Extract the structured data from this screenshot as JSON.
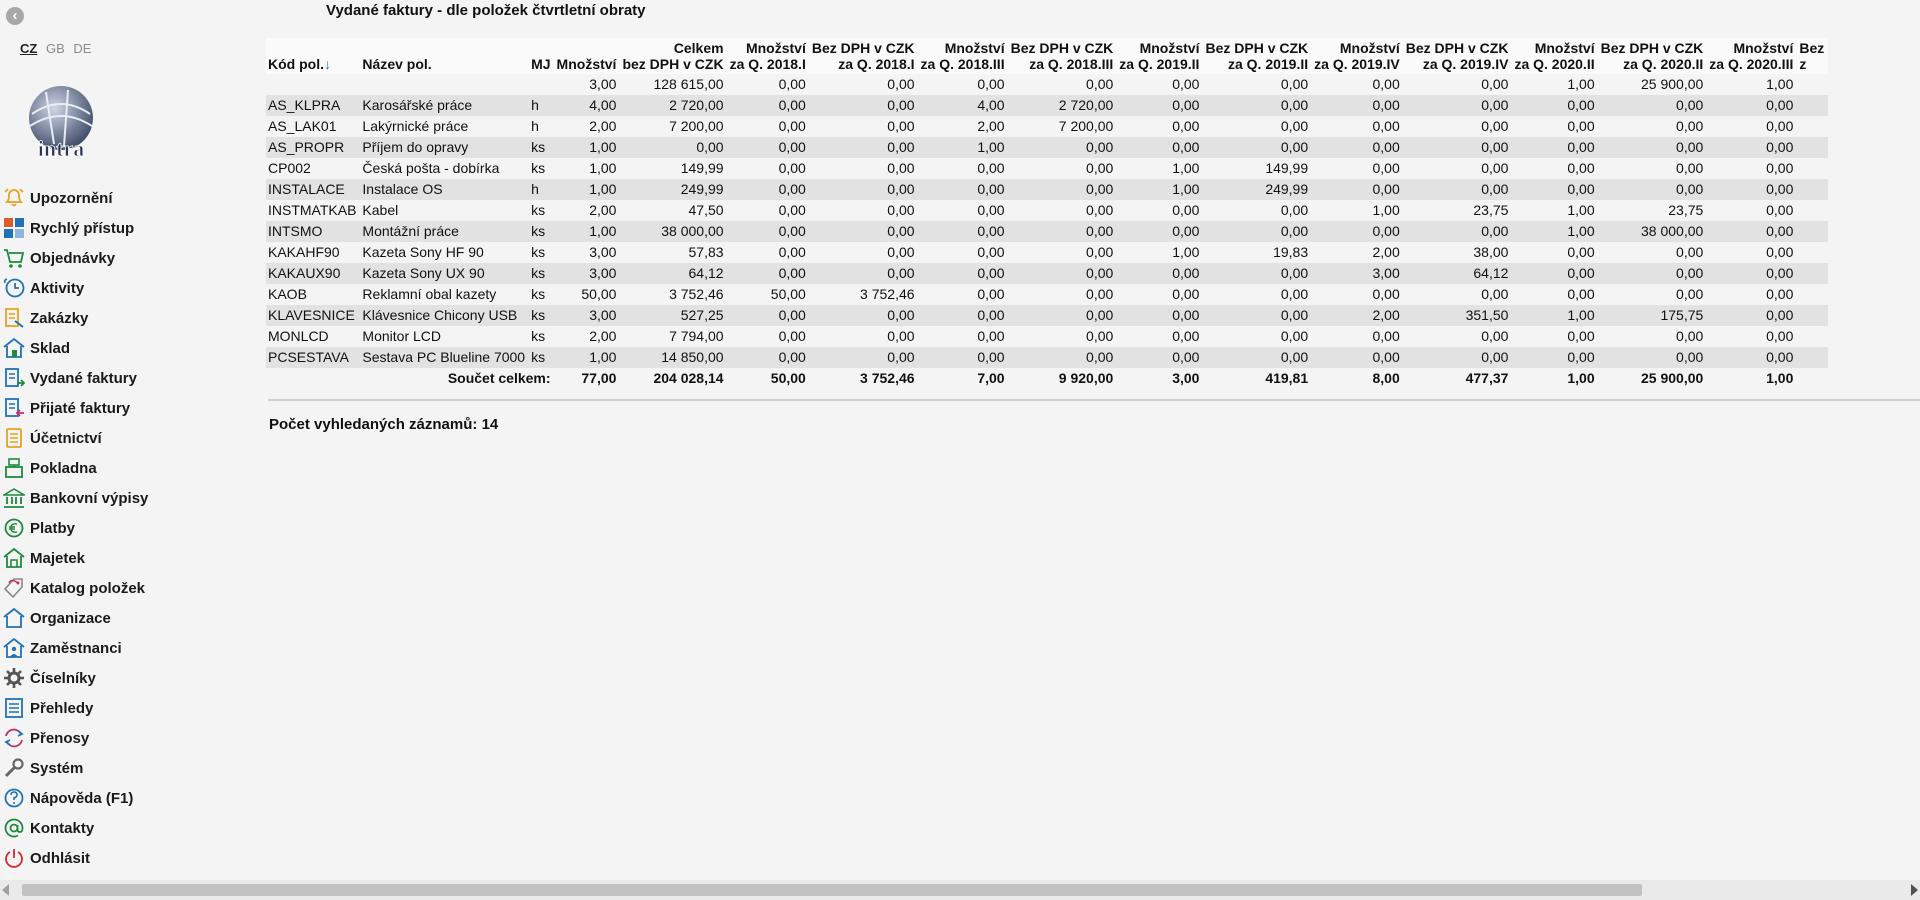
{
  "page_title": "Vydané faktury - dle položek čtvrtletní obraty",
  "languages": [
    "CZ",
    "GB",
    "DE"
  ],
  "logo_text": "intra",
  "nav": [
    {
      "label": "Upozornění",
      "icon": "bell-icon",
      "color": "#e8a21b"
    },
    {
      "label": "Rychlý přístup",
      "icon": "quick-access-icon",
      "color": "#e05a2a"
    },
    {
      "label": "Objednávky",
      "icon": "cart-icon",
      "color": "#1e8a3c"
    },
    {
      "label": "Aktivity",
      "icon": "clock-icon",
      "color": "#1f72b8"
    },
    {
      "label": "Zakázky",
      "icon": "contracts-icon",
      "color": "#e8a21b"
    },
    {
      "label": "Sklad",
      "icon": "warehouse-icon",
      "color": "#1f72b8"
    },
    {
      "label": "Vydané faktury",
      "icon": "issued-invoice-icon",
      "color": "#1f72b8"
    },
    {
      "label": "Přijaté faktury",
      "icon": "received-invoice-icon",
      "color": "#1f72b8"
    },
    {
      "label": "Účetnictví",
      "icon": "accounting-icon",
      "color": "#e8a21b"
    },
    {
      "label": "Pokladna",
      "icon": "cash-register-icon",
      "color": "#1e8a3c"
    },
    {
      "label": "Bankovní výpisy",
      "icon": "bank-icon",
      "color": "#1e8a3c"
    },
    {
      "label": "Platby",
      "icon": "payments-icon",
      "color": "#1e8a3c"
    },
    {
      "label": "Majetek",
      "icon": "property-icon",
      "color": "#1e8a3c"
    },
    {
      "label": "Katalog položek",
      "icon": "tag-icon",
      "color": "#c0306a"
    },
    {
      "label": "Organizace",
      "icon": "organization-icon",
      "color": "#1f72b8"
    },
    {
      "label": "Zaměstnanci",
      "icon": "employees-icon",
      "color": "#1f72b8"
    },
    {
      "label": "Číselníky",
      "icon": "gear-icon",
      "color": "#555555"
    },
    {
      "label": "Přehledy",
      "icon": "list-icon",
      "color": "#1f72b8"
    },
    {
      "label": "Přenosy",
      "icon": "sync-icon",
      "color": "#c0306a"
    },
    {
      "label": "Systém",
      "icon": "wrench-icon",
      "color": "#666666"
    },
    {
      "label": "Nápověda (F1)",
      "icon": "help-icon",
      "color": "#1f72b8"
    },
    {
      "label": "Kontakty",
      "icon": "at-icon",
      "color": "#1e8a3c"
    },
    {
      "label": "Odhlásit",
      "icon": "power-icon",
      "color": "#d62828"
    }
  ],
  "table": {
    "headers": [
      {
        "l1": "",
        "l2": "Kód pol.",
        "sort": "↓",
        "align": "l"
      },
      {
        "l1": "",
        "l2": "Název pol.",
        "align": "l"
      },
      {
        "l1": "",
        "l2": "MJ",
        "align": "l"
      },
      {
        "l1": "",
        "l2": "Množství",
        "align": "r"
      },
      {
        "l1": "Celkem",
        "l2": "bez DPH v CZK",
        "align": "r"
      },
      {
        "l1": "Množství",
        "l2": "za Q. 2018.I",
        "align": "r"
      },
      {
        "l1": "Bez DPH v CZK",
        "l2": "za Q. 2018.I",
        "align": "r"
      },
      {
        "l1": "Množství",
        "l2": "za Q. 2018.III",
        "align": "r"
      },
      {
        "l1": "Bez DPH v CZK",
        "l2": "za Q. 2018.III",
        "align": "r"
      },
      {
        "l1": "Množství",
        "l2": "za Q. 2019.II",
        "align": "r"
      },
      {
        "l1": "Bez DPH v CZK",
        "l2": "za Q. 2019.II",
        "align": "r"
      },
      {
        "l1": "Množství",
        "l2": "za Q. 2019.IV",
        "align": "r"
      },
      {
        "l1": "Bez DPH v CZK",
        "l2": "za Q. 2019.IV",
        "align": "r"
      },
      {
        "l1": "Množství",
        "l2": "za Q. 2020.II",
        "align": "r"
      },
      {
        "l1": "Bez DPH v CZK",
        "l2": "za Q. 2020.II",
        "align": "r"
      },
      {
        "l1": "Množství",
        "l2": "za Q. 2020.III",
        "align": "r"
      },
      {
        "l1": "Bez",
        "l2": "z",
        "align": "l"
      }
    ],
    "rows": [
      [
        "",
        "",
        "",
        "3,00",
        "128 615,00",
        "0,00",
        "0,00",
        "0,00",
        "0,00",
        "0,00",
        "0,00",
        "0,00",
        "0,00",
        "1,00",
        "25 900,00",
        "1,00",
        ""
      ],
      [
        "AS_KLPRA",
        "Karosářské práce",
        "h",
        "4,00",
        "2 720,00",
        "0,00",
        "0,00",
        "4,00",
        "2 720,00",
        "0,00",
        "0,00",
        "0,00",
        "0,00",
        "0,00",
        "0,00",
        "0,00",
        ""
      ],
      [
        "AS_LAK01",
        "Lakýrnické práce",
        "h",
        "2,00",
        "7 200,00",
        "0,00",
        "0,00",
        "2,00",
        "7 200,00",
        "0,00",
        "0,00",
        "0,00",
        "0,00",
        "0,00",
        "0,00",
        "0,00",
        ""
      ],
      [
        "AS_PROPR",
        "Příjem do opravy",
        "ks",
        "1,00",
        "0,00",
        "0,00",
        "0,00",
        "1,00",
        "0,00",
        "0,00",
        "0,00",
        "0,00",
        "0,00",
        "0,00",
        "0,00",
        "0,00",
        ""
      ],
      [
        "CP002",
        "Česká pošta - dobírka",
        "ks",
        "1,00",
        "149,99",
        "0,00",
        "0,00",
        "0,00",
        "0,00",
        "1,00",
        "149,99",
        "0,00",
        "0,00",
        "0,00",
        "0,00",
        "0,00",
        ""
      ],
      [
        "INSTALACE",
        "Instalace OS",
        "h",
        "1,00",
        "249,99",
        "0,00",
        "0,00",
        "0,00",
        "0,00",
        "1,00",
        "249,99",
        "0,00",
        "0,00",
        "0,00",
        "0,00",
        "0,00",
        ""
      ],
      [
        "INSTMATKAB",
        "Kabel",
        "ks",
        "2,00",
        "47,50",
        "0,00",
        "0,00",
        "0,00",
        "0,00",
        "0,00",
        "0,00",
        "1,00",
        "23,75",
        "1,00",
        "23,75",
        "0,00",
        ""
      ],
      [
        "INTSMO",
        "Montážní práce",
        "ks",
        "1,00",
        "38 000,00",
        "0,00",
        "0,00",
        "0,00",
        "0,00",
        "0,00",
        "0,00",
        "0,00",
        "0,00",
        "1,00",
        "38 000,00",
        "0,00",
        ""
      ],
      [
        "KAKAHF90",
        "Kazeta Sony HF 90",
        "ks",
        "3,00",
        "57,83",
        "0,00",
        "0,00",
        "0,00",
        "0,00",
        "1,00",
        "19,83",
        "2,00",
        "38,00",
        "0,00",
        "0,00",
        "0,00",
        ""
      ],
      [
        "KAKAUX90",
        "Kazeta Sony UX 90",
        "ks",
        "3,00",
        "64,12",
        "0,00",
        "0,00",
        "0,00",
        "0,00",
        "0,00",
        "0,00",
        "3,00",
        "64,12",
        "0,00",
        "0,00",
        "0,00",
        ""
      ],
      [
        "KAOB",
        "Reklamní obal kazety",
        "ks",
        "50,00",
        "3 752,46",
        "50,00",
        "3 752,46",
        "0,00",
        "0,00",
        "0,00",
        "0,00",
        "0,00",
        "0,00",
        "0,00",
        "0,00",
        "0,00",
        ""
      ],
      [
        "KLAVESNICE",
        "Klávesnice Chicony USB",
        "ks",
        "3,00",
        "527,25",
        "0,00",
        "0,00",
        "0,00",
        "0,00",
        "0,00",
        "0,00",
        "2,00",
        "351,50",
        "1,00",
        "175,75",
        "0,00",
        ""
      ],
      [
        "MONLCD",
        "Monitor LCD",
        "ks",
        "2,00",
        "7 794,00",
        "0,00",
        "0,00",
        "0,00",
        "0,00",
        "0,00",
        "0,00",
        "0,00",
        "0,00",
        "0,00",
        "0,00",
        "0,00",
        ""
      ],
      [
        "PCSESTAVA",
        "Sestava PC Blueline 7000",
        "ks",
        "1,00",
        "14 850,00",
        "0,00",
        "0,00",
        "0,00",
        "0,00",
        "0,00",
        "0,00",
        "0,00",
        "0,00",
        "0,00",
        "0,00",
        "0,00",
        ""
      ]
    ],
    "totals_label": "Součet celkem:",
    "totals": [
      "77,00",
      "204 028,14",
      "50,00",
      "3 752,46",
      "7,00",
      "9 920,00",
      "3,00",
      "419,81",
      "8,00",
      "477,37",
      "1,00",
      "25 900,00",
      "1,00"
    ]
  },
  "record_count": "Počet vyhledaných záznamů: 14"
}
